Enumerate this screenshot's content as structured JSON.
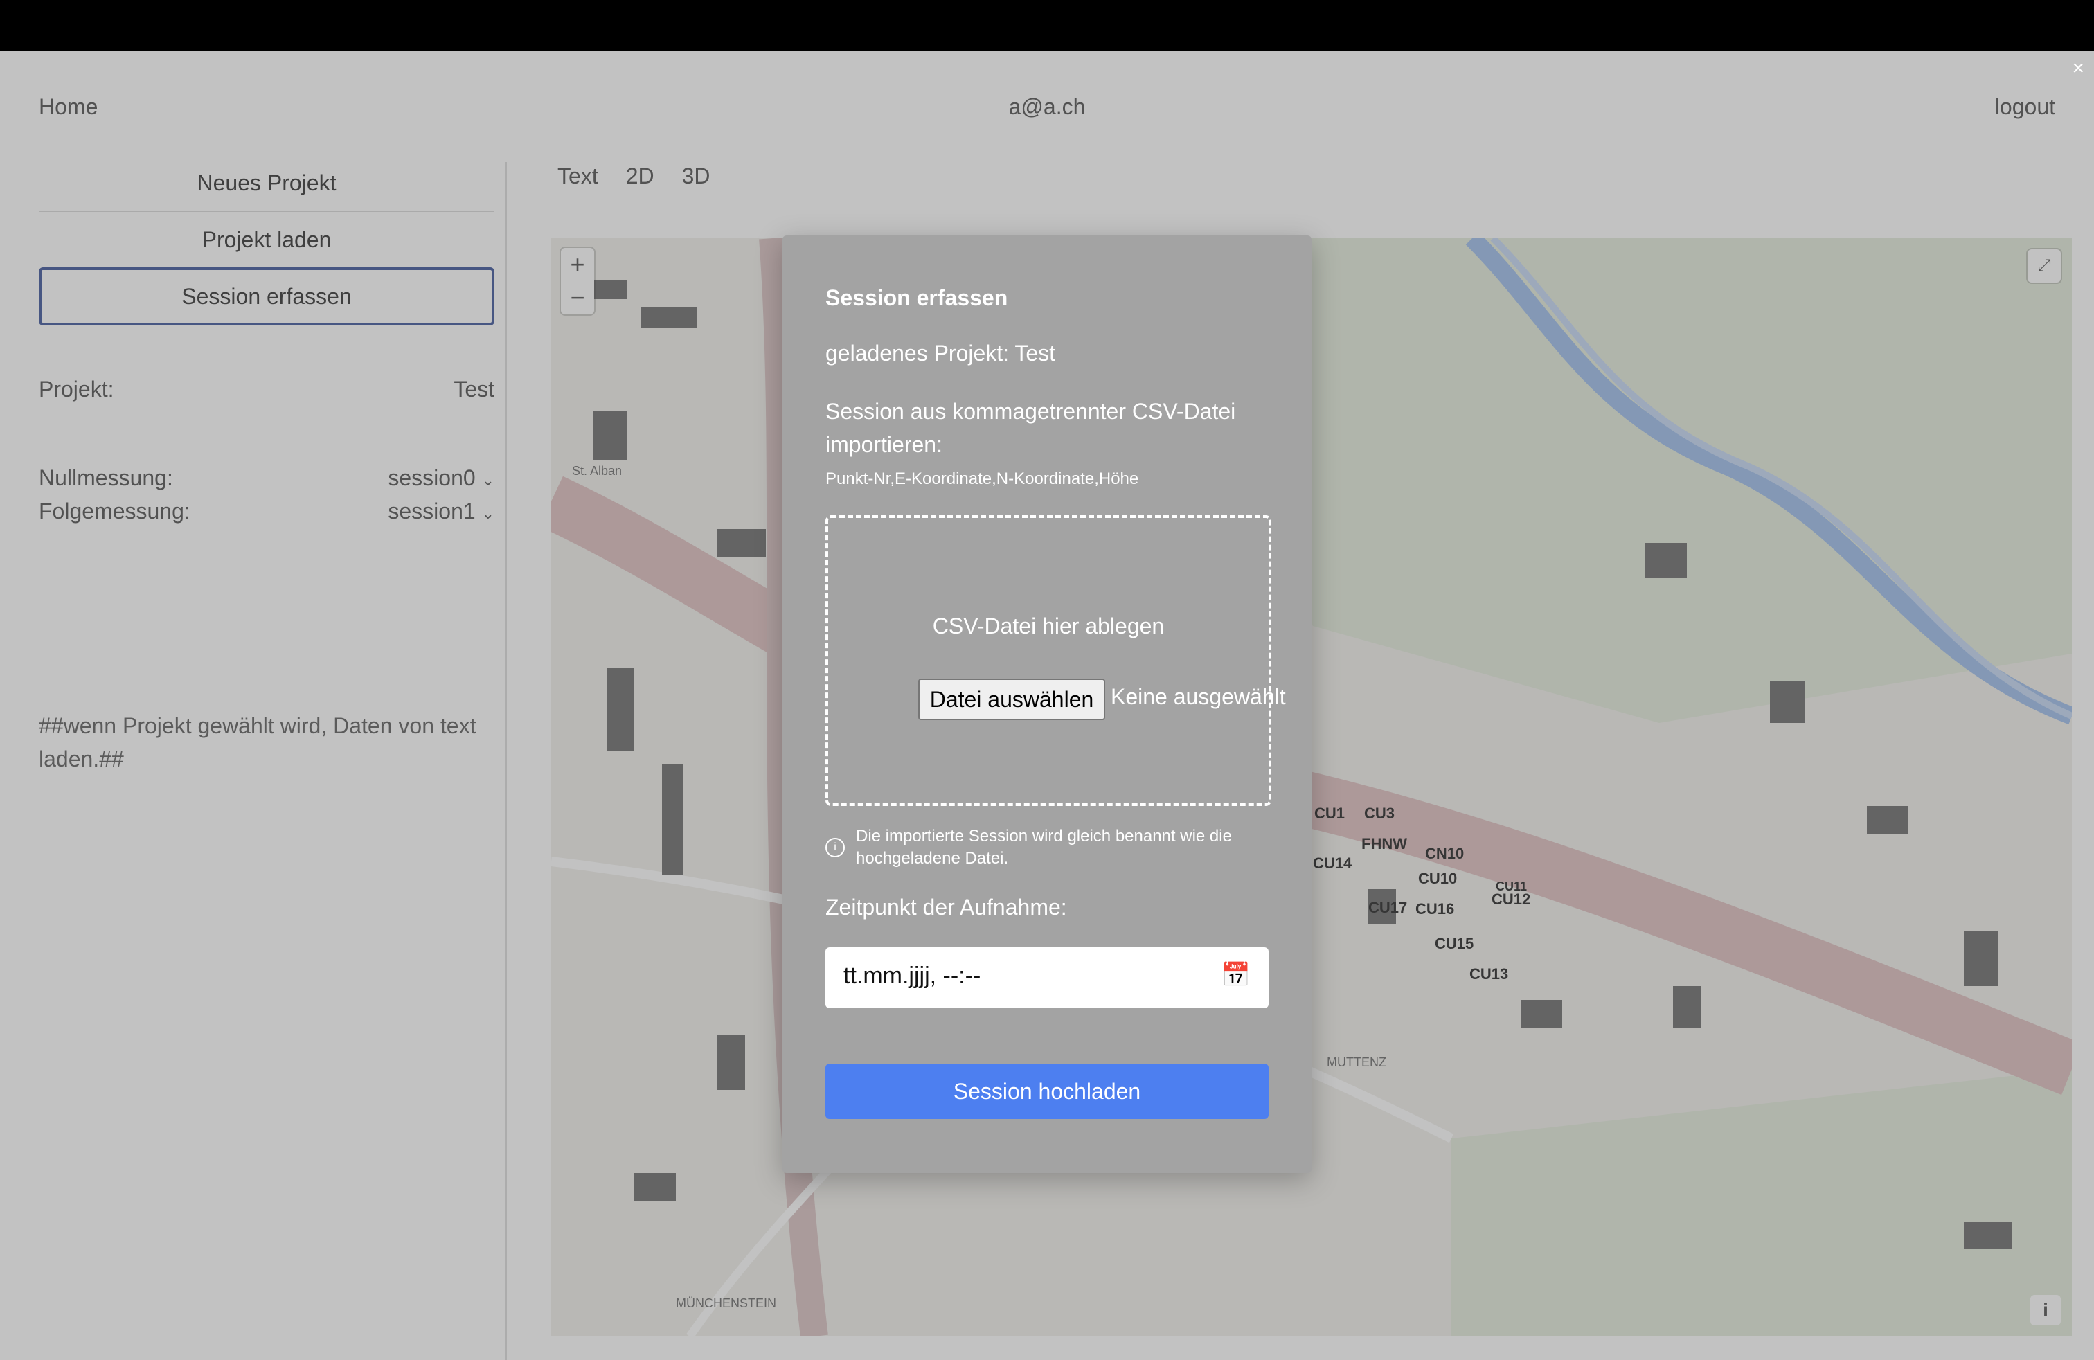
{
  "nav": {
    "home": "Home",
    "user": "a@a.ch",
    "logout": "logout",
    "close": "×"
  },
  "sidebar": {
    "new_project": "Neues Projekt",
    "load_project": "Projekt laden",
    "capture_session": "Session erfassen",
    "project_label": "Projekt:",
    "project_value": "Test",
    "null_label": "Nullmessung:",
    "null_value": "session0",
    "follow_label": "Folgemessung:",
    "follow_value": "session1",
    "note": "##wenn Projekt gewählt wird, Daten von text laden.##"
  },
  "tabs": [
    "Text",
    "2D",
    "3D"
  ],
  "map": {
    "zoom_in": "+",
    "zoom_out": "−",
    "fullscreen": "⤢",
    "info": "i",
    "place_labels": [
      "St. Alban",
      "MUTTENZ",
      "MÜNCHENSTEIN"
    ],
    "points": [
      "CU1",
      "CU3",
      "FHNW",
      "CN10",
      "CU10",
      "CU14",
      "CU17",
      "CU16",
      "CU12",
      "CU15",
      "CU13",
      "CU11"
    ]
  },
  "modal": {
    "title": "Session erfassen",
    "loaded_project": "geladenes Projekt: Test",
    "import_text": "Session aus kommagetrennter CSV-Datei importieren:",
    "format": "Punkt-Nr,E-Koordinate,N-Koordinate,Höhe",
    "drop_text": "CSV-Datei hier ablegen",
    "file_button": "Datei auswählen",
    "file_none": "Keine ausgewählt",
    "info_text": "Die importierte Session wird gleich benannt wie die hochgeladene Datei.",
    "time_label": "Zeitpunkt der Aufnahme:",
    "datetime_placeholder": "tt.mm.jjjj, --:--",
    "upload_button": "Session hochladen"
  },
  "colors": {
    "primary": "#4d7ff0",
    "active_border": "#1f3b8a",
    "marker": "#c0392b"
  }
}
